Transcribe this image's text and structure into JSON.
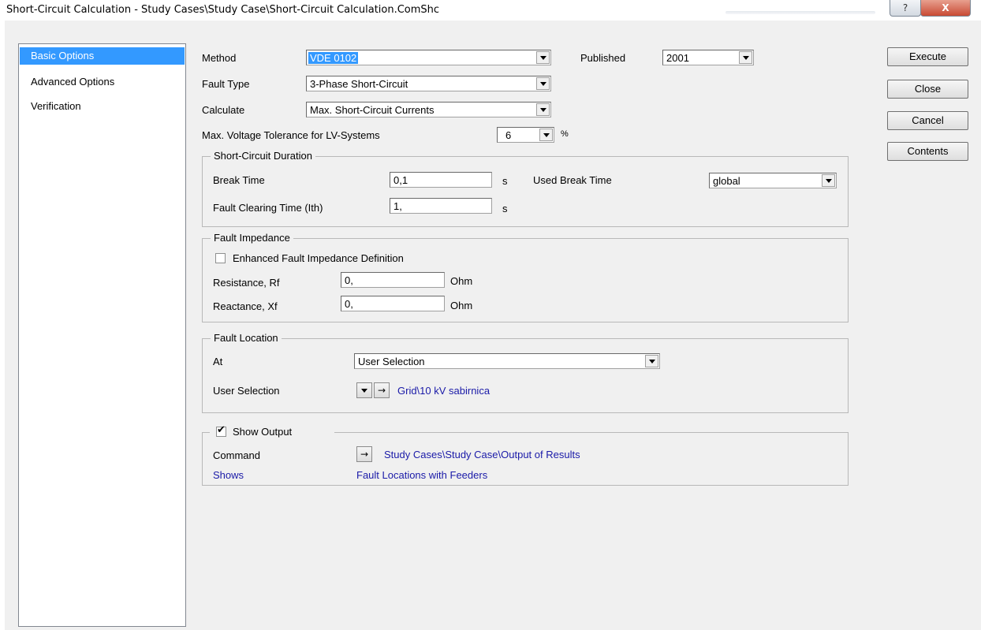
{
  "window": {
    "title": "Short-Circuit Calculation - Study Cases\\Study Case\\Short-Circuit Calculation.ComShc",
    "help_icon": "?",
    "close_icon": "X"
  },
  "sidebar": {
    "items": [
      {
        "label": "Basic Options",
        "selected": true
      },
      {
        "label": "Advanced Options",
        "selected": false
      },
      {
        "label": "Verification",
        "selected": false
      }
    ]
  },
  "basic": {
    "method_label": "Method",
    "method_value": "VDE 0102",
    "published_label": "Published",
    "published_value": "2001",
    "fault_type_label": "Fault Type",
    "fault_type_value": "3-Phase Short-Circuit",
    "calculate_label": "Calculate",
    "calculate_value": "Max. Short-Circuit Currents",
    "max_voltage_label": "Max. Voltage Tolerance for LV-Systems",
    "max_voltage_value": "6",
    "max_voltage_unit": "%"
  },
  "duration": {
    "title": "Short-Circuit Duration",
    "break_time_label": "Break Time",
    "break_time_value": "0,1",
    "break_time_unit": "s",
    "used_break_time_label": "Used Break Time",
    "used_break_time_value": "global",
    "clearing_label": "Fault Clearing Time (Ith)",
    "clearing_value": "1,",
    "clearing_unit": "s"
  },
  "impedance": {
    "title": "Fault Impedance",
    "enhanced_label": "Enhanced Fault Impedance Definition",
    "enhanced_checked": false,
    "resistance_label": "Resistance, Rf",
    "resistance_value": "0,",
    "resistance_unit": "Ohm",
    "reactance_label": "Reactance, Xf",
    "reactance_value": "0,",
    "reactance_unit": "Ohm"
  },
  "location": {
    "title": "Fault Location",
    "at_label": "At",
    "at_value": "User Selection",
    "user_selection_label": "User Selection",
    "user_selection_value": "Grid\\10 kV sabirnica"
  },
  "output": {
    "title": "Show Output",
    "checked": true,
    "command_label": "Command",
    "command_value": "Study Cases\\Study Case\\Output of Results",
    "shows_label": "Shows",
    "shows_value": "Fault Locations with Feeders"
  },
  "buttons": {
    "execute": "Execute",
    "close": "Close",
    "cancel": "Cancel",
    "contents": "Contents"
  },
  "icons": {
    "arrow_right": "→",
    "checkmark": "✔"
  }
}
